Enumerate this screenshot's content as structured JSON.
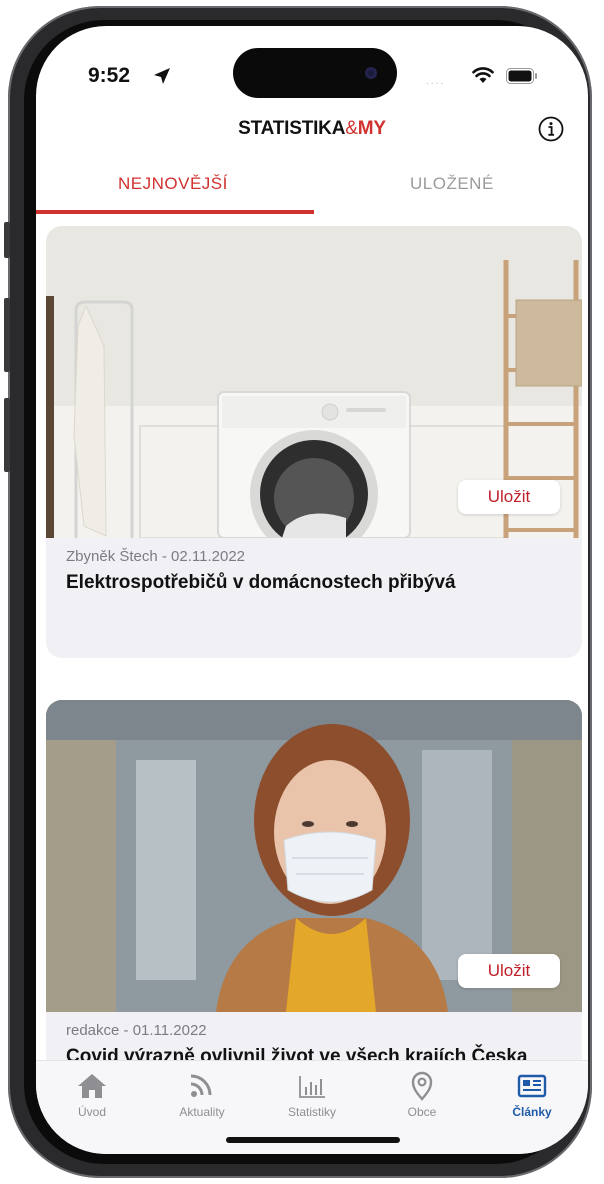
{
  "status_bar": {
    "time": "9:52",
    "signal_dots": "....",
    "icons": [
      "location-arrow-icon",
      "wifi-icon",
      "battery-icon"
    ]
  },
  "header": {
    "title_part1": "STATISTIKA",
    "title_amp": "&",
    "title_part2": "MY",
    "info_icon": "info-icon"
  },
  "tabs": [
    {
      "label": "NEJNOVĚJŠÍ",
      "active": true
    },
    {
      "label": "ULOŽENÉ",
      "active": false
    }
  ],
  "articles": [
    {
      "meta": "Zbyněk Štech - 02.11.2022",
      "title": "Elektrospotřebičů v domácnostech přibývá",
      "save_label": "Uložit",
      "image": "laundry-room-washing-machine"
    },
    {
      "meta": "redakce - 01.11.2022",
      "title": "Covid výrazně ovlivnil život ve všech krajích Česka",
      "save_label": "Uložit",
      "image": "woman-with-face-mask"
    }
  ],
  "tab_bar": {
    "items": [
      {
        "label": "Úvod",
        "icon": "home-icon",
        "active": false
      },
      {
        "label": "Aktuality",
        "icon": "rss-icon",
        "active": false
      },
      {
        "label": "Statistiky",
        "icon": "bar-chart-icon",
        "active": false
      },
      {
        "label": "Obce",
        "icon": "map-pin-icon",
        "active": false
      },
      {
        "label": "Články",
        "icon": "newspaper-icon",
        "active": true
      }
    ]
  },
  "colors": {
    "accent": "#d0322f",
    "active_nav": "#1f5aa8",
    "inactive": "#8e8e93"
  }
}
